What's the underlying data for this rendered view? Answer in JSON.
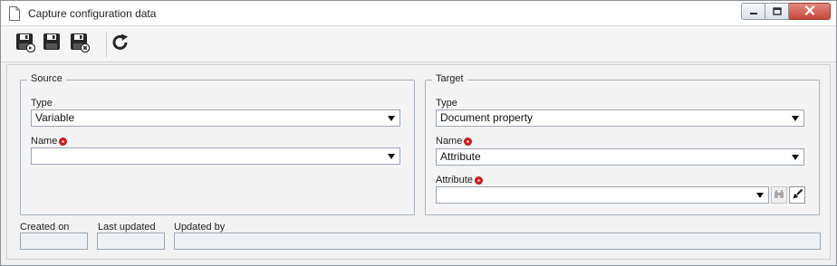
{
  "window": {
    "title": "Capture configuration data",
    "icons": {
      "title": "document-icon",
      "minimize": "minimize-icon",
      "maximize": "maximize-icon",
      "close": "close-icon"
    }
  },
  "toolbar": {
    "buttons": [
      {
        "name": "save-and-new-button",
        "icon": "save-new-icon"
      },
      {
        "name": "save-button",
        "icon": "save-icon"
      },
      {
        "name": "save-and-close-button",
        "icon": "save-close-icon"
      },
      {
        "name": "refresh-button",
        "icon": "refresh-icon"
      }
    ]
  },
  "source": {
    "legend": "Source",
    "type_label": "Type",
    "type_value": "Variable",
    "name_label": "Name",
    "name_value": ""
  },
  "target": {
    "legend": "Target",
    "type_label": "Type",
    "type_value": "Document property",
    "name_label": "Name",
    "name_value": "Attribute",
    "attribute_label": "Attribute",
    "attribute_value": ""
  },
  "footer": {
    "created_on_label": "Created on",
    "created_on_value": "",
    "last_updated_label": "Last updated",
    "last_updated_value": "",
    "updated_by_label": "Updated by",
    "updated_by_value": ""
  },
  "colors": {
    "required": "#d62020",
    "close_button": "#c8473a",
    "field_border": "#9aa6b3"
  }
}
